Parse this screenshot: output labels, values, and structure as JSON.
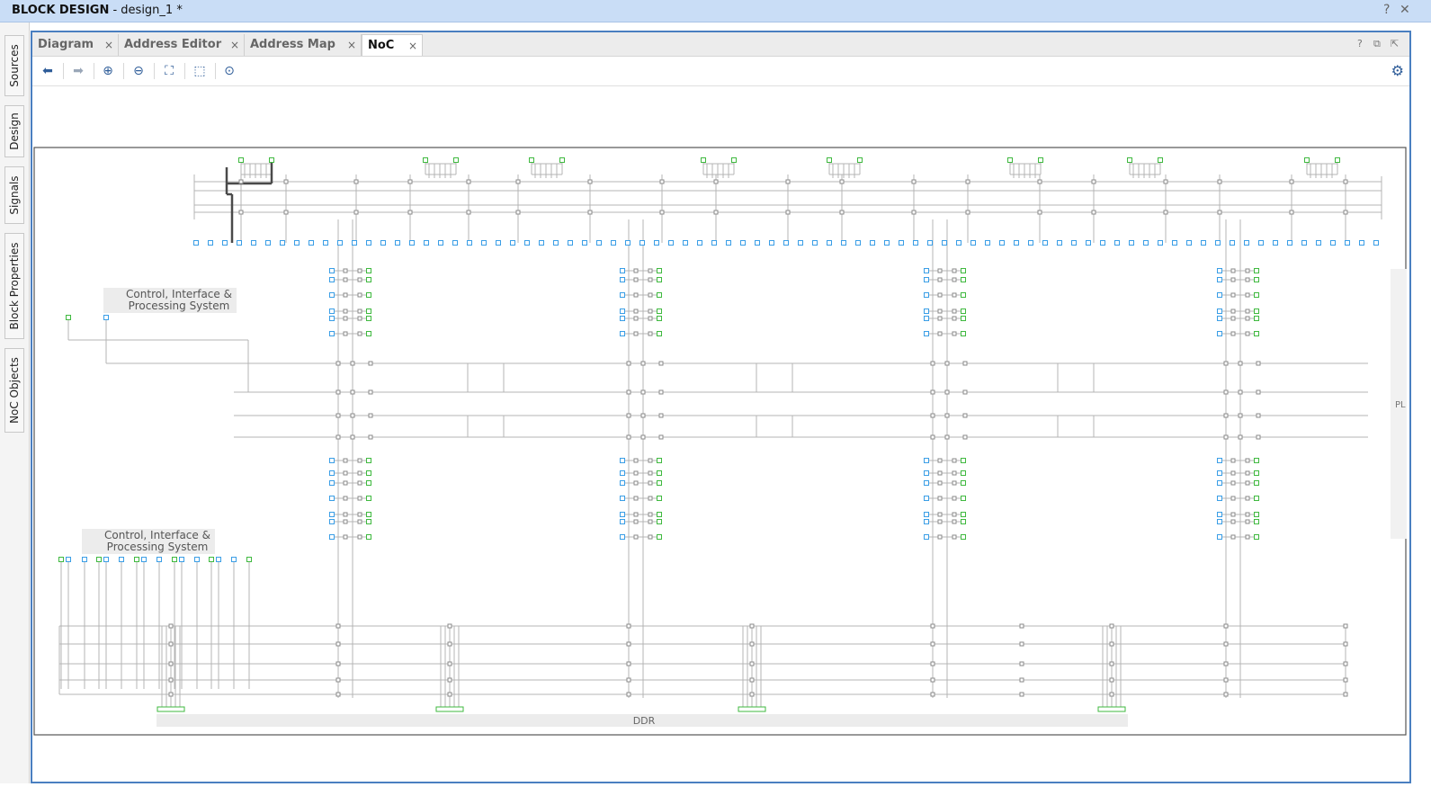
{
  "window": {
    "title_bold": "BLOCK DESIGN",
    "title_rest": " - design_1 *",
    "help_glyph": "?",
    "close_glyph": "✕"
  },
  "sidebar": {
    "tabs": [
      {
        "label": "Sources"
      },
      {
        "label": "Design"
      },
      {
        "label": "Signals"
      },
      {
        "label": "Block Properties"
      },
      {
        "label": "NoC Objects"
      }
    ]
  },
  "tabs": [
    {
      "label": "Diagram"
    },
    {
      "label": "Address Editor"
    },
    {
      "label": "Address Map"
    },
    {
      "label": "NoC"
    }
  ],
  "active_tab": "NoC",
  "tab_close_glyph": "×",
  "tab_right_icons": [
    {
      "name": "help-icon",
      "glyph": "?"
    },
    {
      "name": "restore-icon",
      "glyph": "⧉"
    },
    {
      "name": "float-icon",
      "glyph": "⇱"
    }
  ],
  "toolbar": {
    "buttons": [
      {
        "name": "back-icon",
        "glyph": "⬅",
        "enabled": true
      },
      {
        "name": "forward-icon",
        "glyph": "➡",
        "enabled": false
      },
      {
        "name": "zoom-in-icon",
        "glyph": "⊕",
        "enabled": true
      },
      {
        "name": "zoom-out-icon",
        "glyph": "⊖",
        "enabled": true
      },
      {
        "name": "zoom-fit-icon",
        "glyph": "⛶",
        "enabled": true
      },
      {
        "name": "zoom-area-icon",
        "glyph": "⬚",
        "enabled": true
      },
      {
        "name": "auto-fit-icon",
        "glyph": "⊙",
        "enabled": true
      }
    ],
    "settings_glyph": "⚙"
  },
  "diagram": {
    "labels": {
      "cips_top_line1": "Control, Interface &",
      "cips_top_line2": "Processing System",
      "cips_bottom_line1": "Control, Interface &",
      "cips_bottom_line2": "Processing System",
      "ddr": "DDR",
      "pl": "PL"
    },
    "colors": {
      "wire": "#b4b4b4",
      "wire_selected": "#4a4a4a",
      "master_port": "#3fb93f",
      "slave_port": "#3a9ee6",
      "node": "#8a8a8a",
      "label_bg": "#ececec"
    }
  }
}
